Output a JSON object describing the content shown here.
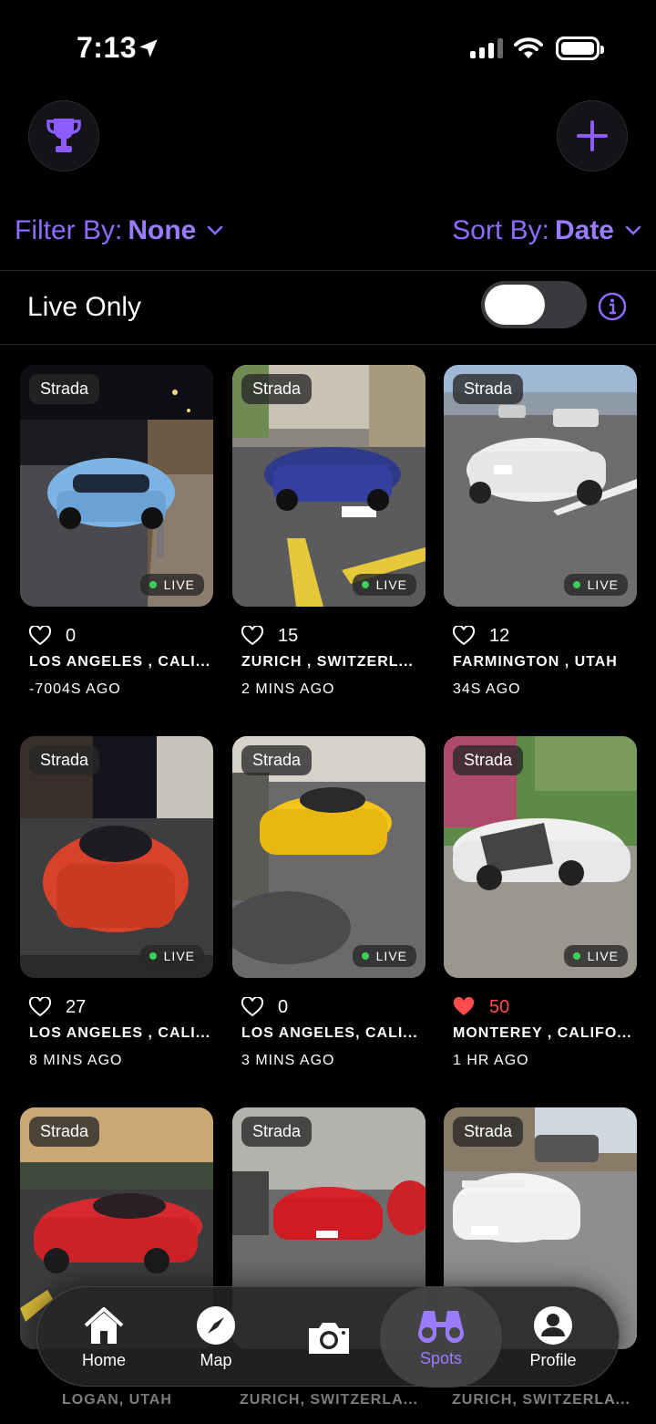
{
  "status": {
    "time": "7:13"
  },
  "filters": {
    "filter_label": "Filter By:",
    "filter_value": "None",
    "sort_label": "Sort By:",
    "sort_value": "Date"
  },
  "live_only": {
    "label": "Live Only",
    "enabled": false
  },
  "colors": {
    "accent": "#8d6cff",
    "live_dot": "#3ccf5a",
    "liked": "#ff4b4b"
  },
  "posts": [
    {
      "tag": "Strada",
      "live": "LIVE",
      "likes": "0",
      "liked": false,
      "location": "LOS ANGELES , CALI...",
      "ago": "-7004S AGO"
    },
    {
      "tag": "Strada",
      "live": "LIVE",
      "likes": "15",
      "liked": false,
      "location": "ZURICH , SWITZERL...",
      "ago": "2 MINS AGO"
    },
    {
      "tag": "Strada",
      "live": "LIVE",
      "likes": "12",
      "liked": false,
      "location": "FARMINGTON , UTAH",
      "ago": "34S AGO"
    },
    {
      "tag": "Strada",
      "live": "LIVE",
      "likes": "27",
      "liked": false,
      "location": "LOS ANGELES , CALI...",
      "ago": "8 MINS AGO"
    },
    {
      "tag": "Strada",
      "live": "LIVE",
      "likes": "0",
      "liked": false,
      "location": "LOS ANGELES, CALI...",
      "ago": "3 MINS AGO"
    },
    {
      "tag": "Strada",
      "live": "LIVE",
      "likes": "50",
      "liked": true,
      "location": "MONTEREY , CALIFO...",
      "ago": "1 HR AGO"
    },
    {
      "tag": "Strada",
      "live": "",
      "likes": "",
      "liked": false,
      "location": "LOGAN, UTAH",
      "ago": ""
    },
    {
      "tag": "Strada",
      "live": "",
      "likes": "",
      "liked": false,
      "location": "ZURICH, SWITZERLA...",
      "ago": ""
    },
    {
      "tag": "Strada",
      "live": "",
      "likes": "",
      "liked": false,
      "location": "ZURICH, SWITZERLA...",
      "ago": ""
    }
  ],
  "tabs": [
    {
      "label": "Home",
      "icon": "house-icon"
    },
    {
      "label": "Map",
      "icon": "compass-icon"
    },
    {
      "label": "",
      "icon": "camera-icon"
    },
    {
      "label": "Spots",
      "icon": "binoculars-icon"
    },
    {
      "label": "Profile",
      "icon": "person-icon"
    }
  ]
}
